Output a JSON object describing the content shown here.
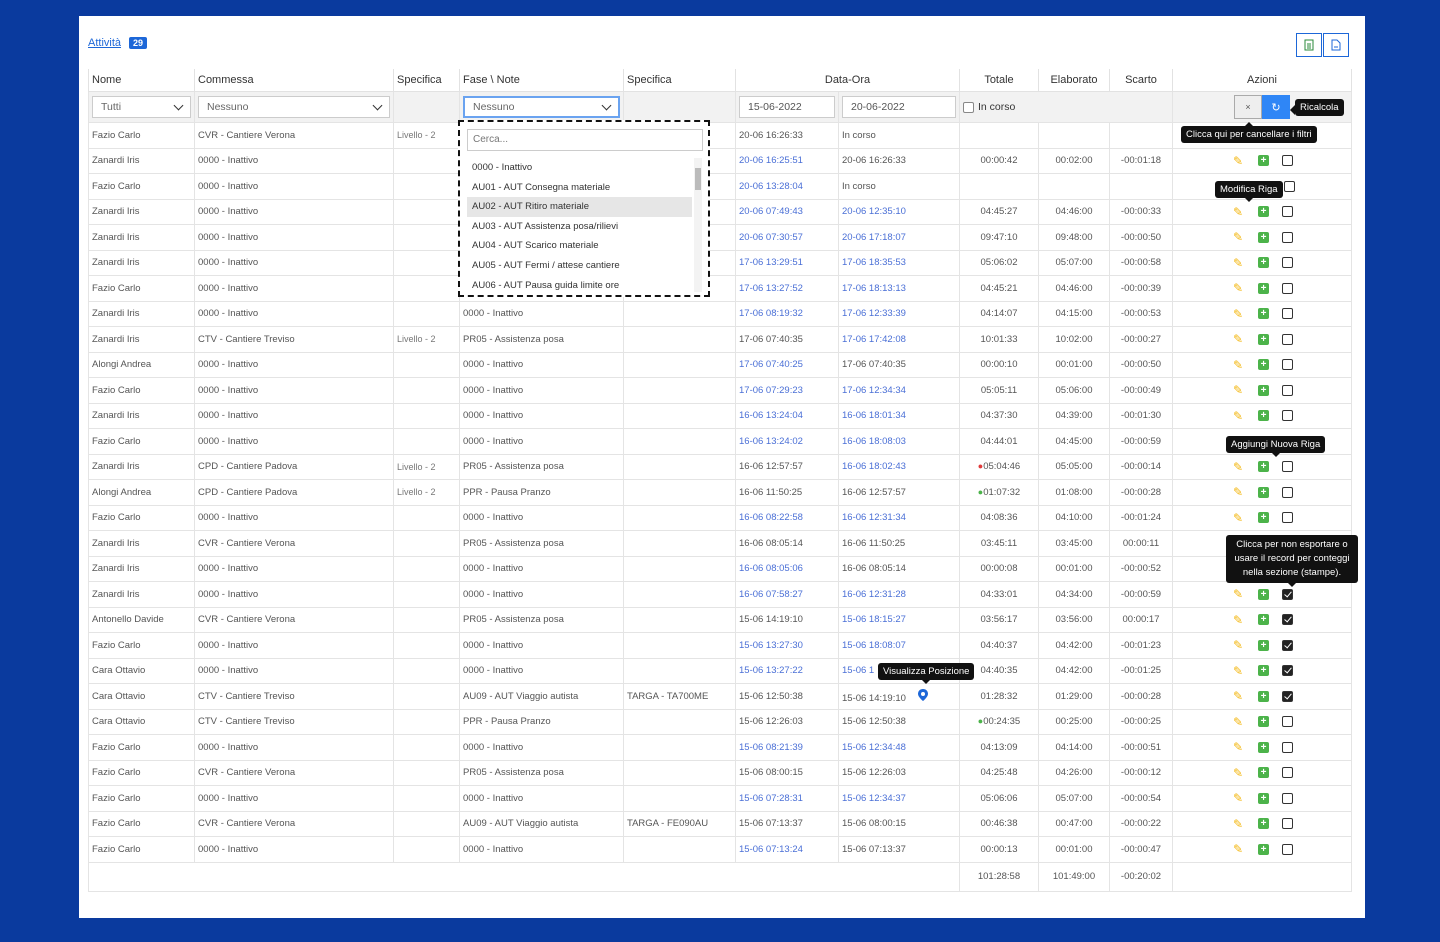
{
  "header": {
    "title": "Attività",
    "count": "29"
  },
  "columns": [
    "Nome",
    "Commessa",
    "Specifica",
    "Fase \\ Note",
    "Specifica",
    "Data-Ora",
    "Totale",
    "Elaborato",
    "Scarto",
    "Azioni"
  ],
  "filters": {
    "nome": "Tutti",
    "commessa": "Nessuno",
    "fase": "Nessuno",
    "date_from": "15-06-2022",
    "date_to": "20-06-2022",
    "in_corso_label": "In corso",
    "clear_icon": "×",
    "recalc_icon": "↻"
  },
  "dropdown": {
    "placeholder": "Cerca...",
    "items": [
      "0000 - Inattivo",
      "AU01 - AUT Consegna materiale",
      "AU02 - AUT Ritiro materiale",
      "AU03 - AUT Assistenza posa/rilievi",
      "AU04 - AUT Scarico materiale",
      "AU05 - AUT Fermi / attese cantiere",
      "AU06 - AUT Pausa guida limite ore"
    ],
    "highlighted_index": 2
  },
  "tooltips": {
    "ricalcola": "Ricalcola",
    "cancella": "Clicca qui per cancellare i filtri",
    "modifica": "Modifica Riga",
    "aggiungi": "Aggiungi Nuova Riga",
    "esporta": "Clicca per non esportare o usare il record per conteggi nella sezione (stampe).",
    "posizione": "Visualizza Posizione"
  },
  "rows": [
    {
      "nome": "Fazio Carlo",
      "commessa": "CVR - Cantiere Verona",
      "spec": "Livello - 2",
      "fase": "",
      "spec2": "",
      "start": "20-06 16:26:33",
      "start_link": false,
      "end": "In corso",
      "end_link": false,
      "totale": "",
      "elaborato": "",
      "scarto": "",
      "actions": false,
      "checked": false
    },
    {
      "nome": "Zanardi Iris",
      "commessa": "0000 - Inattivo",
      "spec": "",
      "fase": "",
      "spec2": "",
      "start": "20-06 16:25:51",
      "start_link": true,
      "end": "20-06 16:26:33",
      "end_link": false,
      "totale": "00:00:42",
      "elaborato": "00:02:00",
      "scarto": "-00:01:18",
      "actions": true,
      "checked": false
    },
    {
      "nome": "Fazio Carlo",
      "commessa": "0000 - Inattivo",
      "spec": "",
      "fase": "",
      "spec2": "",
      "start": "20-06 13:28:04",
      "start_link": true,
      "end": "In corso",
      "end_link": false,
      "totale": "",
      "elaborato": "",
      "scarto": "",
      "actions": false,
      "checked": false
    },
    {
      "nome": "Zanardi Iris",
      "commessa": "0000 - Inattivo",
      "spec": "",
      "fase": "",
      "spec2": "",
      "start": "20-06 07:49:43",
      "start_link": true,
      "end": "20-06 12:35:10",
      "end_link": true,
      "totale": "04:45:27",
      "elaborato": "04:46:00",
      "scarto": "-00:00:33",
      "actions": true,
      "checked": false
    },
    {
      "nome": "Zanardi Iris",
      "commessa": "0000 - Inattivo",
      "spec": "",
      "fase": "",
      "spec2": "",
      "start": "20-06 07:30:57",
      "start_link": true,
      "end": "20-06 17:18:07",
      "end_link": true,
      "totale": "09:47:10",
      "elaborato": "09:48:00",
      "scarto": "-00:00:50",
      "actions": true,
      "checked": false
    },
    {
      "nome": "Zanardi Iris",
      "commessa": "0000 - Inattivo",
      "spec": "",
      "fase": "",
      "spec2": "",
      "start": "17-06 13:29:51",
      "start_link": true,
      "end": "17-06 18:35:53",
      "end_link": true,
      "totale": "05:06:02",
      "elaborato": "05:07:00",
      "scarto": "-00:00:58",
      "actions": true,
      "checked": false
    },
    {
      "nome": "Fazio Carlo",
      "commessa": "0000 - Inattivo",
      "spec": "",
      "fase": "",
      "spec2": "",
      "start": "17-06 13:27:52",
      "start_link": true,
      "end": "17-06 18:13:13",
      "end_link": true,
      "totale": "04:45:21",
      "elaborato": "04:46:00",
      "scarto": "-00:00:39",
      "actions": true,
      "checked": false
    },
    {
      "nome": "Zanardi Iris",
      "commessa": "0000 - Inattivo",
      "spec": "",
      "fase": "0000 - Inattivo",
      "spec2": "",
      "start": "17-06 08:19:32",
      "start_link": true,
      "end": "17-06 12:33:39",
      "end_link": true,
      "totale": "04:14:07",
      "elaborato": "04:15:00",
      "scarto": "-00:00:53",
      "actions": true,
      "checked": false
    },
    {
      "nome": "Zanardi Iris",
      "commessa": "CTV - Cantiere Treviso",
      "spec": "Livello - 2",
      "fase": "PR05 - Assistenza posa",
      "spec2": "",
      "start": "17-06 07:40:35",
      "start_link": false,
      "end": "17-06 17:42:08",
      "end_link": true,
      "totale": "10:01:33",
      "elaborato": "10:02:00",
      "scarto": "-00:00:27",
      "actions": true,
      "checked": false
    },
    {
      "nome": "Alongi Andrea",
      "commessa": "0000 - Inattivo",
      "spec": "",
      "fase": "0000 - Inattivo",
      "spec2": "",
      "start": "17-06 07:40:25",
      "start_link": true,
      "end": "17-06 07:40:35",
      "end_link": false,
      "totale": "00:00:10",
      "elaborato": "00:01:00",
      "scarto": "-00:00:50",
      "actions": true,
      "checked": false
    },
    {
      "nome": "Fazio Carlo",
      "commessa": "0000 - Inattivo",
      "spec": "",
      "fase": "0000 - Inattivo",
      "spec2": "",
      "start": "17-06 07:29:23",
      "start_link": true,
      "end": "17-06 12:34:34",
      "end_link": true,
      "totale": "05:05:11",
      "elaborato": "05:06:00",
      "scarto": "-00:00:49",
      "actions": true,
      "checked": false
    },
    {
      "nome": "Zanardi Iris",
      "commessa": "0000 - Inattivo",
      "spec": "",
      "fase": "0000 - Inattivo",
      "spec2": "",
      "start": "16-06 13:24:04",
      "start_link": true,
      "end": "16-06 18:01:34",
      "end_link": true,
      "totale": "04:37:30",
      "elaborato": "04:39:00",
      "scarto": "-00:01:30",
      "actions": true,
      "checked": false
    },
    {
      "nome": "Fazio Carlo",
      "commessa": "0000 - Inattivo",
      "spec": "",
      "fase": "0000 - Inattivo",
      "spec2": "",
      "start": "16-06 13:24:02",
      "start_link": true,
      "end": "16-06 18:08:03",
      "end_link": true,
      "totale": "04:44:01",
      "elaborato": "04:45:00",
      "scarto": "-00:00:59",
      "actions": false,
      "checked": false
    },
    {
      "nome": "Zanardi Iris",
      "commessa": "CPD - Cantiere Padova",
      "spec": "Livello - 2",
      "fase": "PR05 - Assistenza posa",
      "spec2": "",
      "start": "16-06 12:57:57",
      "start_link": false,
      "end": "16-06 18:02:43",
      "end_link": true,
      "totale": "05:04:46",
      "thumb": "down",
      "elaborato": "05:05:00",
      "scarto": "-00:00:14",
      "actions": true,
      "checked": false
    },
    {
      "nome": "Alongi Andrea",
      "commessa": "CPD - Cantiere Padova",
      "spec": "Livello - 2",
      "fase": "PPR - Pausa Pranzo",
      "spec2": "",
      "start": "16-06 11:50:25",
      "start_link": false,
      "end": "16-06 12:57:57",
      "end_link": false,
      "totale": "01:07:32",
      "thumb": "up",
      "elaborato": "01:08:00",
      "scarto": "-00:00:28",
      "actions": true,
      "checked": false
    },
    {
      "nome": "Fazio Carlo",
      "commessa": "0000 - Inattivo",
      "spec": "",
      "fase": "0000 - Inattivo",
      "spec2": "",
      "start": "16-06 08:22:58",
      "start_link": true,
      "end": "16-06 12:31:34",
      "end_link": true,
      "totale": "04:08:36",
      "elaborato": "04:10:00",
      "scarto": "-00:01:24",
      "actions": true,
      "checked": false
    },
    {
      "nome": "Zanardi Iris",
      "commessa": "CVR - Cantiere Verona",
      "spec": "",
      "fase": "PR05 - Assistenza posa",
      "spec2": "",
      "start": "16-06 08:05:14",
      "start_link": false,
      "end": "16-06 11:50:25",
      "end_link": false,
      "totale": "03:45:11",
      "elaborato": "03:45:00",
      "scarto": "00:00:11",
      "actions": false,
      "checked": false
    },
    {
      "nome": "Zanardi Iris",
      "commessa": "0000 - Inattivo",
      "spec": "",
      "fase": "0000 - Inattivo",
      "spec2": "",
      "start": "16-06 08:05:06",
      "start_link": true,
      "end": "16-06 08:05:14",
      "end_link": false,
      "totale": "00:00:08",
      "elaborato": "00:01:00",
      "scarto": "-00:00:52",
      "actions": false,
      "checked": false
    },
    {
      "nome": "Zanardi Iris",
      "commessa": "0000 - Inattivo",
      "spec": "",
      "fase": "0000 - Inattivo",
      "spec2": "",
      "start": "16-06 07:58:27",
      "start_link": true,
      "end": "16-06 12:31:28",
      "end_link": true,
      "totale": "04:33:01",
      "elaborato": "04:34:00",
      "scarto": "-00:00:59",
      "actions": true,
      "checked": true
    },
    {
      "nome": "Antonello Davide",
      "commessa": "CVR - Cantiere Verona",
      "spec": "",
      "fase": "PR05 - Assistenza posa",
      "spec2": "",
      "start": "15-06 14:19:10",
      "start_link": false,
      "end": "15-06 18:15:27",
      "end_link": true,
      "totale": "03:56:17",
      "elaborato": "03:56:00",
      "scarto": "00:00:17",
      "actions": true,
      "checked": true
    },
    {
      "nome": "Fazio Carlo",
      "commessa": "0000 - Inattivo",
      "spec": "",
      "fase": "0000 - Inattivo",
      "spec2": "",
      "start": "15-06 13:27:30",
      "start_link": true,
      "end": "15-06 18:08:07",
      "end_link": true,
      "totale": "04:40:37",
      "elaborato": "04:42:00",
      "scarto": "-00:01:23",
      "actions": true,
      "checked": true
    },
    {
      "nome": "Cara Ottavio",
      "commessa": "0000 - Inattivo",
      "spec": "",
      "fase": "0000 - Inattivo",
      "spec2": "",
      "start": "15-06 13:27:22",
      "start_link": true,
      "end": "15-06 1",
      "end_link": true,
      "totale": "04:40:35",
      "elaborato": "04:42:00",
      "scarto": "-00:01:25",
      "actions": true,
      "checked": true
    },
    {
      "nome": "Cara Ottavio",
      "commessa": "CTV - Cantiere Treviso",
      "spec": "",
      "fase": "AU09 - AUT Viaggio autista",
      "spec2": "TARGA - TA700ME",
      "start": "15-06 12:50:38",
      "start_link": false,
      "end": "15-06 14:19:10",
      "end_link": false,
      "pin": true,
      "totale": "01:28:32",
      "elaborato": "01:29:00",
      "scarto": "-00:00:28",
      "actions": true,
      "checked": true
    },
    {
      "nome": "Cara Ottavio",
      "commessa": "CTV - Cantiere Treviso",
      "spec": "",
      "fase": "PPR - Pausa Pranzo",
      "spec2": "",
      "start": "15-06 12:26:03",
      "start_link": false,
      "end": "15-06 12:50:38",
      "end_link": false,
      "totale": "00:24:35",
      "thumb": "up",
      "elaborato": "00:25:00",
      "scarto": "-00:00:25",
      "actions": true,
      "checked": false
    },
    {
      "nome": "Fazio Carlo",
      "commessa": "0000 - Inattivo",
      "spec": "",
      "fase": "0000 - Inattivo",
      "spec2": "",
      "start": "15-06 08:21:39",
      "start_link": true,
      "end": "15-06 12:34:48",
      "end_link": true,
      "totale": "04:13:09",
      "elaborato": "04:14:00",
      "scarto": "-00:00:51",
      "actions": true,
      "checked": false
    },
    {
      "nome": "Fazio Carlo",
      "commessa": "CVR - Cantiere Verona",
      "spec": "",
      "fase": "PR05 - Assistenza posa",
      "spec2": "",
      "start": "15-06 08:00:15",
      "start_link": false,
      "end": "15-06 12:26:03",
      "end_link": false,
      "totale": "04:25:48",
      "elaborato": "04:26:00",
      "scarto": "-00:00:12",
      "actions": true,
      "checked": false
    },
    {
      "nome": "Fazio Carlo",
      "commessa": "0000 - Inattivo",
      "spec": "",
      "fase": "0000 - Inattivo",
      "spec2": "",
      "start": "15-06 07:28:31",
      "start_link": true,
      "end": "15-06 12:34:37",
      "end_link": true,
      "totale": "05:06:06",
      "elaborato": "05:07:00",
      "scarto": "-00:00:54",
      "actions": true,
      "checked": false
    },
    {
      "nome": "Fazio Carlo",
      "commessa": "CVR - Cantiere Verona",
      "spec": "",
      "fase": "AU09 - AUT Viaggio autista",
      "spec2": "TARGA - FE090AU",
      "start": "15-06 07:13:37",
      "start_link": false,
      "end": "15-06 08:00:15",
      "end_link": false,
      "totale": "00:46:38",
      "elaborato": "00:47:00",
      "scarto": "-00:00:22",
      "actions": true,
      "checked": false
    },
    {
      "nome": "Fazio Carlo",
      "commessa": "0000 - Inattivo",
      "spec": "",
      "fase": "0000 - Inattivo",
      "spec2": "",
      "start": "15-06 07:13:24",
      "start_link": true,
      "end": "15-06 07:13:37",
      "end_link": false,
      "totale": "00:00:13",
      "elaborato": "00:01:00",
      "scarto": "-00:00:47",
      "actions": true,
      "checked": false
    }
  ],
  "totals": {
    "totale": "101:28:58",
    "elaborato": "101:49:00",
    "scarto": "-00:20:02"
  },
  "colors": {
    "background": "#0a3a9e",
    "link": "#4a6fd6",
    "accent": "#2f86f6",
    "plus": "#4cb34a",
    "pencil": "#f3b60f"
  }
}
